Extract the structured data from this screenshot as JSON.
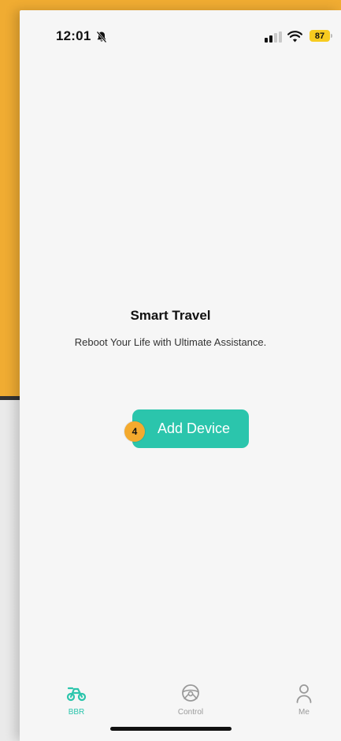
{
  "status_bar": {
    "time": "12:01",
    "battery": "87",
    "bell_icon": "bell-slash-icon",
    "signal_icon": "cellular-signal-icon",
    "wifi_icon": "wifi-icon"
  },
  "main": {
    "title": "Smart Travel",
    "subtitle": "Reboot Your Life with Ultimate Assistance.",
    "add_button_label": "Add Device",
    "step_badge": "4"
  },
  "tabbar": {
    "items": [
      {
        "label": "BBR",
        "icon": "bike-icon",
        "active": true
      },
      {
        "label": "Control",
        "icon": "steering-wheel-icon",
        "active": false
      },
      {
        "label": "Me",
        "icon": "person-icon",
        "active": false
      }
    ]
  },
  "colors": {
    "accent": "#2bc5ac",
    "inactive": "#9a9a9a",
    "battery": "#f7cb20",
    "badge": "#f4aa2e",
    "background_orange": "#f0ac32"
  }
}
